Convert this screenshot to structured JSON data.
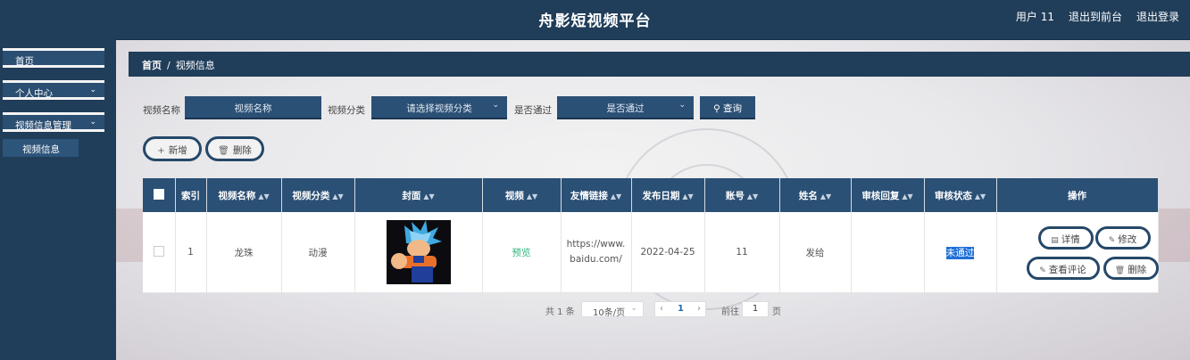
{
  "app": {
    "title": "舟影短视频平台"
  },
  "header": {
    "user": "用户 11",
    "front": "退出到前台",
    "logout": "退出登录"
  },
  "sidebar": {
    "items": [
      {
        "label": "首页"
      },
      {
        "label": "个人中心"
      },
      {
        "label": "视频信息管理"
      }
    ],
    "sub": {
      "label": "视频信息"
    }
  },
  "breadcrumb": {
    "home": "首页",
    "sep": "/",
    "current": "视频信息"
  },
  "search": {
    "name_label": "视频名称",
    "name_placeholder": "视频名称",
    "cat_label": "视频分类",
    "cat_placeholder": "请选择视频分类",
    "pass_label": "是否通过",
    "pass_placeholder": "是否通过",
    "query": "查询"
  },
  "actions": {
    "add": "新增",
    "delete": "删除"
  },
  "table": {
    "headers": [
      "索引",
      "视频名称",
      "视频分类",
      "封面",
      "视频",
      "友情链接",
      "发布日期",
      "账号",
      "姓名",
      "审核回复",
      "审核状态",
      "操作"
    ],
    "row": {
      "index": "1",
      "name": "龙珠",
      "category": "动漫",
      "video": "预览",
      "link": "https://www.baidu.com/",
      "date": "2022-04-25",
      "account": "11",
      "person": "发给",
      "reply": "",
      "status": "未通过",
      "ops": {
        "detail": "详情",
        "edit": "修改",
        "comments": "查看评论",
        "delete": "删除"
      }
    }
  },
  "pagination": {
    "total": "共 1 条",
    "size": "10条/页",
    "current": "1",
    "goto": "前往",
    "goto_value": "1",
    "page": "页"
  },
  "colors": {
    "navy": "#203d59",
    "accent": "#2b5075",
    "status_bg": "#1e6fd9",
    "preview": "#2fb57d"
  }
}
